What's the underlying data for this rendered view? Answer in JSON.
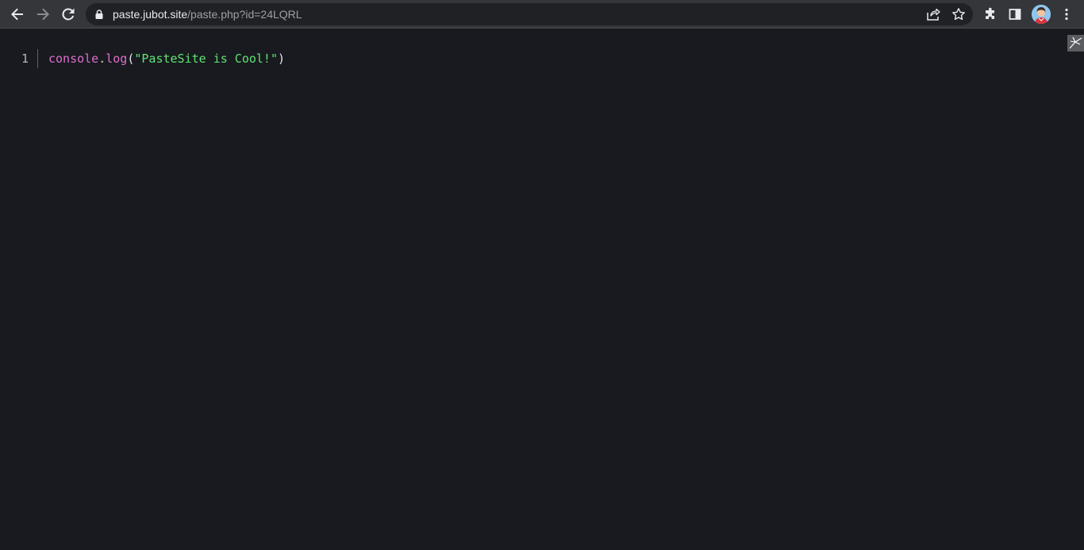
{
  "browser": {
    "url_host": "paste.jubot.site",
    "url_path": "/paste.php?id=24LQRL",
    "colors": {
      "toolbar": "#35363a",
      "omnibox": "#202124",
      "host_text": "#e8eaed",
      "path_text": "#9aa0a6"
    },
    "icons": {
      "back": "arrow-left-icon",
      "forward": "arrow-right-icon",
      "reload": "reload-icon",
      "lock": "lock-icon",
      "share": "share-icon",
      "bookmark": "star-icon",
      "extensions": "puzzle-icon",
      "side_panel": "side-panel-icon",
      "profile": "avatar",
      "menu": "kebab-menu-icon"
    }
  },
  "editor": {
    "background": "#181a1f",
    "lines": [
      {
        "number": "1",
        "tokens": {
          "object": "console",
          "dot": ".",
          "method": "log",
          "open_paren": "(",
          "string": "\"PasteSite is Cool!\"",
          "close_paren": ")"
        }
      }
    ],
    "token_colors": {
      "identifier": "#e06ecb",
      "string": "#5fe374",
      "punctuation": "#e3e5ea"
    }
  }
}
